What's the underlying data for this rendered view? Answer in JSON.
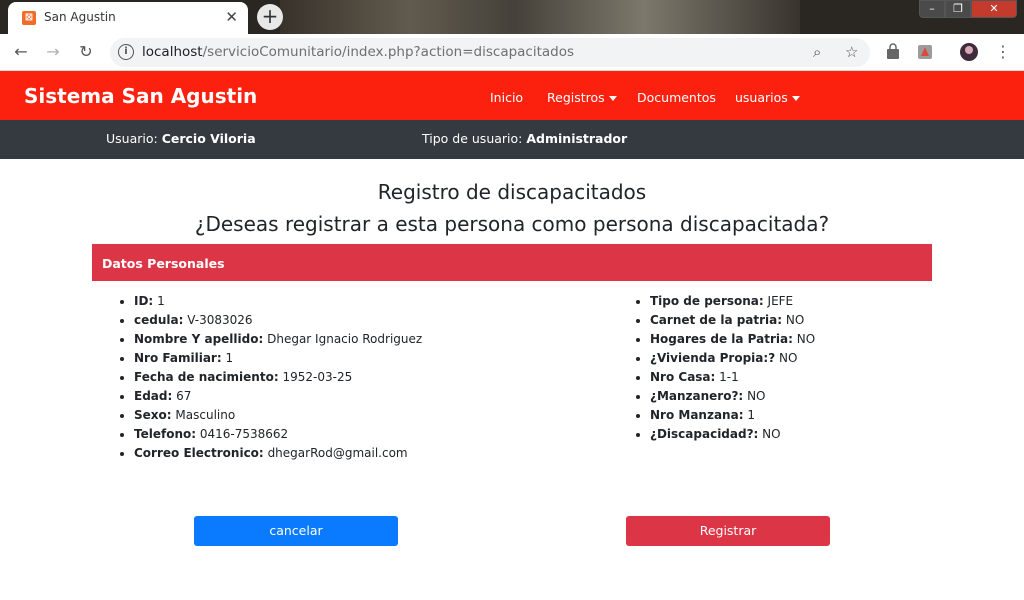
{
  "browser": {
    "tab_title": "San Agustin",
    "url_host": "localhost",
    "url_rest": "/servicioComunitario/index.php?action=discapacitados"
  },
  "app": {
    "brand": "Sistema San Agustin",
    "nav": [
      "Inicio",
      "Registros",
      "Documentos",
      "usuarios"
    ],
    "user_label": "Usuario:",
    "user_name": "Cercio Viloria",
    "type_label": "Tipo de usuario:",
    "type_value": "Administrador"
  },
  "page": {
    "title": "Registro de discapacitados",
    "subtitle": "¿Deseas registrar a esta persona como persona discapacitada?",
    "card_header": "Datos Personales",
    "left": [
      {
        "label": "ID:",
        "value": "1"
      },
      {
        "label": "cedula:",
        "value": "V-3083026"
      },
      {
        "label": "Nombre Y apellido:",
        "value": "Dhegar Ignacio Rodriguez"
      },
      {
        "label": "Nro Familiar:",
        "value": "1"
      },
      {
        "label": "Fecha de nacimiento:",
        "value": "1952-03-25"
      },
      {
        "label": "Edad:",
        "value": "67"
      },
      {
        "label": "Sexo:",
        "value": "Masculino"
      },
      {
        "label": "Telefono:",
        "value": "0416-7538662"
      },
      {
        "label": "Correo Electronico:",
        "value": "dhegarRod@gmail.com"
      }
    ],
    "right": [
      {
        "label": "Tipo de persona:",
        "value": "JEFE"
      },
      {
        "label": "Carnet de la patria:",
        "value": "NO"
      },
      {
        "label": "Hogares de la Patria:",
        "value": "NO"
      },
      {
        "label": "¿Vivienda Propia:?",
        "value": "NO"
      },
      {
        "label": "Nro Casa:",
        "value": "1-1"
      },
      {
        "label": "¿Manzanero?:",
        "value": "NO"
      },
      {
        "label": "Nro Manzana:",
        "value": "1"
      },
      {
        "label": "¿Discapacidad?:",
        "value": "NO"
      }
    ],
    "cancel_label": "cancelar",
    "submit_label": "Registrar"
  },
  "colors": {
    "navbar": "#fc200e",
    "userbar": "#343a40",
    "danger": "#dc3545",
    "primary": "#0a7bff"
  }
}
